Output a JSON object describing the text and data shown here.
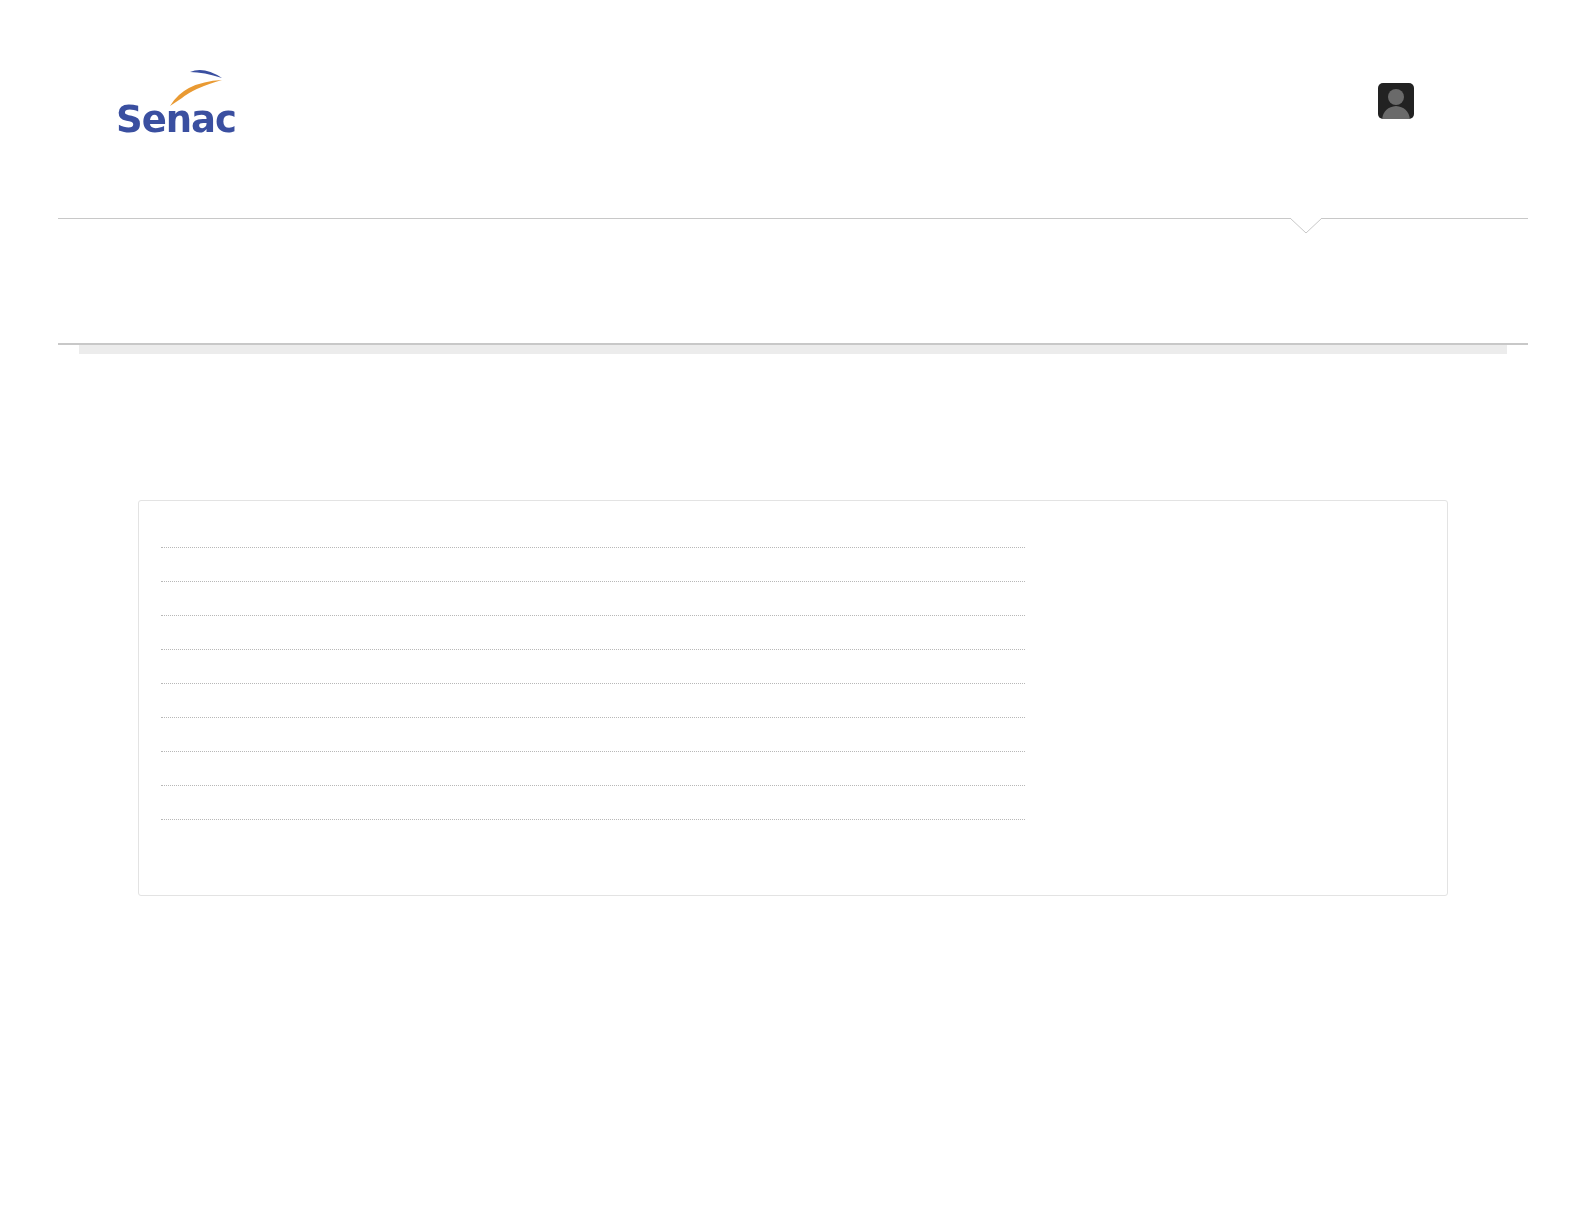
{
  "header": {
    "logo": {
      "text": "Senac"
    }
  }
}
